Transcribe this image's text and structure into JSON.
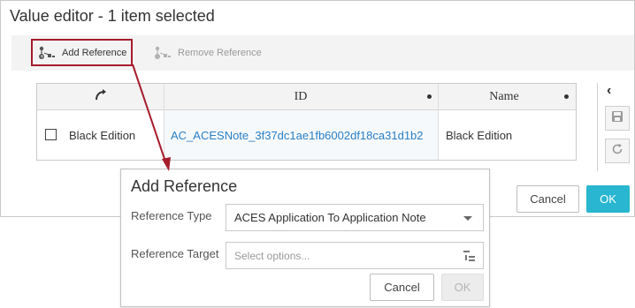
{
  "value_editor": {
    "title": "Value editor - 1 item selected",
    "toolbar": {
      "add_reference": "Add Reference",
      "remove_reference": "Remove Reference"
    },
    "grid": {
      "columns": [
        {
          "label": "",
          "icon": "relation-arrow-icon"
        },
        {
          "label": "ID"
        },
        {
          "label": "Name"
        }
      ],
      "rows": [
        {
          "checked": false,
          "name_left": "Black Edition",
          "id": "AC_ACESNote_3f37dc1ae1fb6002df18ca31d1b2",
          "name": "Black Edition"
        }
      ]
    },
    "side_panel": {
      "collapse_icon": "chevron-left-icon",
      "save_icon": "save-icon",
      "refresh_icon": "refresh-icon"
    },
    "cancel_label": "Cancel",
    "ok_label": "OK"
  },
  "add_reference_dialog": {
    "title": "Add Reference",
    "reference_type_label": "Reference Type",
    "reference_type_value": "ACES Application To Application Note",
    "reference_target_label": "Reference Target",
    "reference_target_placeholder": "Select options...",
    "cancel_label": "Cancel",
    "ok_label": "OK"
  },
  "colors": {
    "accent": "#29b6d0",
    "highlight_border": "#a61c2c",
    "link": "#2a7fc4"
  }
}
